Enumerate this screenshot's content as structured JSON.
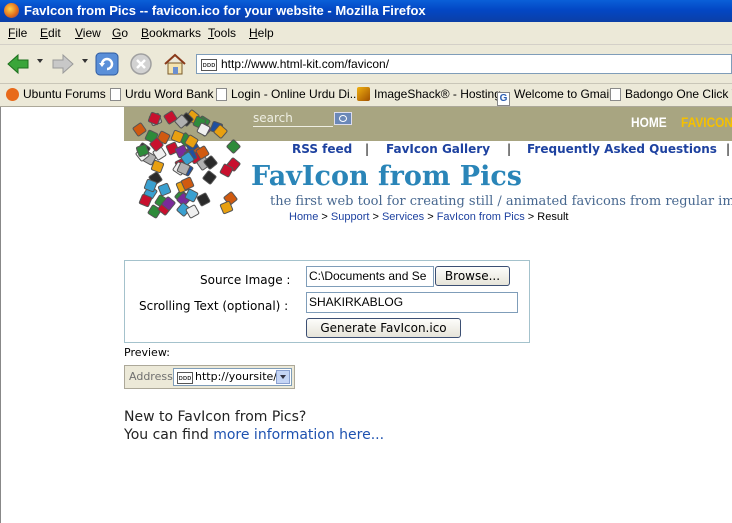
{
  "window": {
    "title": "FavIcon from Pics -- favicon.ico for your website - Mozilla Firefox"
  },
  "menu": [
    "File",
    "Edit",
    "View",
    "Go",
    "Bookmarks",
    "Tools",
    "Help"
  ],
  "address_bar": {
    "url": "http://www.html-kit.com/favicon/"
  },
  "bookmarks": [
    "Ubuntu Forums",
    "Urdu Word Bank",
    "Login - Online Urdu Di...",
    "ImageShack® - Hosting",
    "Welcome to Gmail",
    "Badongo One Click W"
  ],
  "site": {
    "search_placeholder": "search",
    "top_nav": {
      "home": "HOME",
      "favicon": "FAVICON"
    },
    "links": [
      "RSS feed",
      "FavIcon Gallery",
      "Frequently Asked Questions"
    ],
    "link_separator": "|",
    "title": "FavIcon from Pics",
    "tagline": "the first web tool for creating still / animated favicons from regular images",
    "breadcrumb": {
      "home": "Home",
      "support": "Support",
      "services": "Services",
      "favicon": "FavIcon from Pics",
      "current": "Result",
      "sep": " > "
    }
  },
  "form": {
    "source_label": "Source Image :",
    "source_value": "C:\\Documents and Se",
    "browse_label": "Browse...",
    "scroll_label": "Scrolling Text (optional) :",
    "scroll_value": "SHAKIRKABLOG",
    "generate_label": "Generate FavIcon.ico"
  },
  "preview": {
    "label": "Preview:",
    "address_label": "Address",
    "url": "http://yoursite/"
  },
  "info": {
    "line1": "New to FavIcon from Pics?",
    "line2_prefix": "You can find ",
    "line2_link": "more information here..."
  },
  "icons": [
    "firefox-icon",
    "back-icon",
    "forward-icon",
    "reload-icon",
    "stop-icon",
    "home-icon",
    "page-icon",
    "search-icon"
  ]
}
